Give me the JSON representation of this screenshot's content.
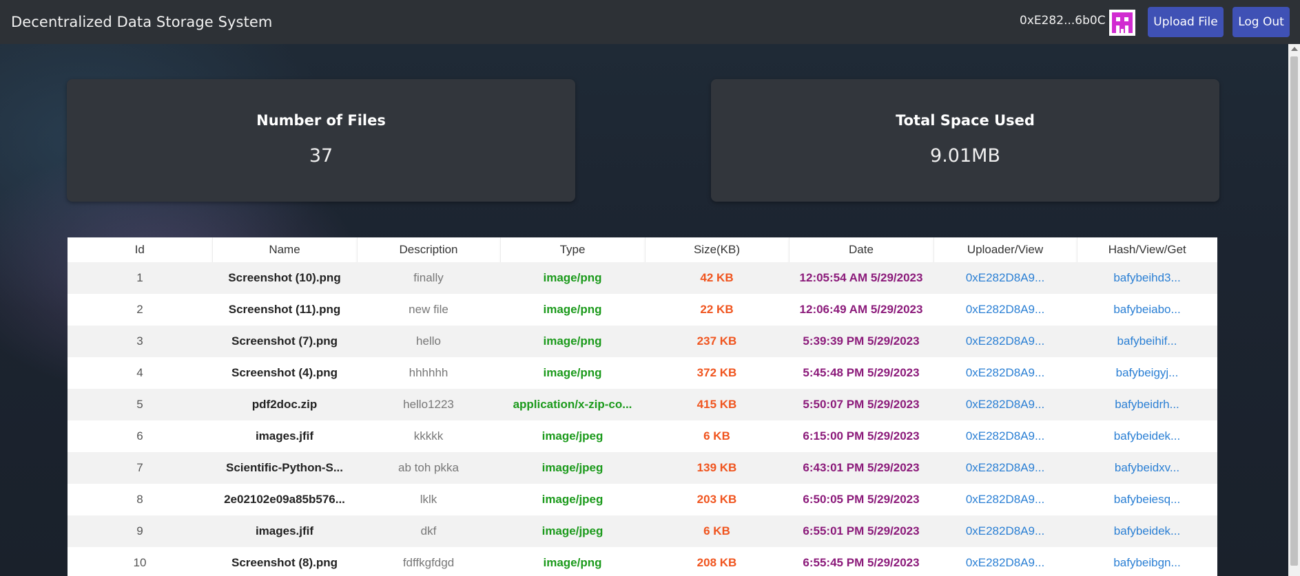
{
  "navbar": {
    "title": "Decentralized Data Storage System",
    "account": "0xE282...6b0C",
    "upload_label": "Upload File",
    "logout_label": "Log Out"
  },
  "stats": {
    "files_title": "Number of Files",
    "files_value": "37",
    "space_title": "Total Space Used",
    "space_value": "9.01MB"
  },
  "table": {
    "headers": [
      "Id",
      "Name",
      "Description",
      "Type",
      "Size(KB)",
      "Date",
      "Uploader/View",
      "Hash/View/Get"
    ],
    "rows": [
      {
        "id": "1",
        "name": "Screenshot (10).png",
        "description": "finally",
        "type": "image/png",
        "size": "42 KB",
        "date": "12:05:54 AM 5/29/2023",
        "uploader": "0xE282D8A9...",
        "hash": "bafybeihd3..."
      },
      {
        "id": "2",
        "name": "Screenshot (11).png",
        "description": "new file",
        "type": "image/png",
        "size": "22 KB",
        "date": "12:06:49 AM 5/29/2023",
        "uploader": "0xE282D8A9...",
        "hash": "bafybeiabo..."
      },
      {
        "id": "3",
        "name": "Screenshot (7).png",
        "description": "hello",
        "type": "image/png",
        "size": "237 KB",
        "date": "5:39:39 PM 5/29/2023",
        "uploader": "0xE282D8A9...",
        "hash": "bafybeihif..."
      },
      {
        "id": "4",
        "name": "Screenshot (4).png",
        "description": "hhhhhh",
        "type": "image/png",
        "size": "372 KB",
        "date": "5:45:48 PM 5/29/2023",
        "uploader": "0xE282D8A9...",
        "hash": "bafybeigyj..."
      },
      {
        "id": "5",
        "name": "pdf2doc.zip",
        "description": "hello1223",
        "type": "application/x-zip-co...",
        "size": "415 KB",
        "date": "5:50:07 PM 5/29/2023",
        "uploader": "0xE282D8A9...",
        "hash": "bafybeidrh..."
      },
      {
        "id": "6",
        "name": "images.jfif",
        "description": "kkkkk",
        "type": "image/jpeg",
        "size": "6 KB",
        "date": "6:15:00 PM 5/29/2023",
        "uploader": "0xE282D8A9...",
        "hash": "bafybeidek..."
      },
      {
        "id": "7",
        "name": "Scientific-Python-S...",
        "description": "ab toh pkka",
        "type": "image/jpeg",
        "size": "139 KB",
        "date": "6:43:01 PM 5/29/2023",
        "uploader": "0xE282D8A9...",
        "hash": "bafybeidxv..."
      },
      {
        "id": "8",
        "name": "2e02102e09a85b576...",
        "description": "lklk",
        "type": "image/jpeg",
        "size": "203 KB",
        "date": "6:50:05 PM 5/29/2023",
        "uploader": "0xE282D8A9...",
        "hash": "bafybeiesq..."
      },
      {
        "id": "9",
        "name": "images.jfif",
        "description": "dkf",
        "type": "image/jpeg",
        "size": "6 KB",
        "date": "6:55:01 PM 5/29/2023",
        "uploader": "0xE282D8A9...",
        "hash": "bafybeidek..."
      },
      {
        "id": "10",
        "name": "Screenshot (8).png",
        "description": "fdffkgfdgd",
        "type": "image/png",
        "size": "208 KB",
        "date": "6:55:45 PM 5/29/2023",
        "uploader": "0xE282D8A9...",
        "hash": "bafybeibgn..."
      }
    ]
  },
  "icons": {
    "avatar": "identicon-avatar",
    "scroll_up": "scroll-up-arrow-icon"
  },
  "colors": {
    "navbar": "#2d3136",
    "button": "#3f51b5",
    "card": "#32363c",
    "type": "#1b9a1b",
    "size": "#f0541e",
    "date": "#8b1a7a",
    "link": "#2a7fd4"
  }
}
